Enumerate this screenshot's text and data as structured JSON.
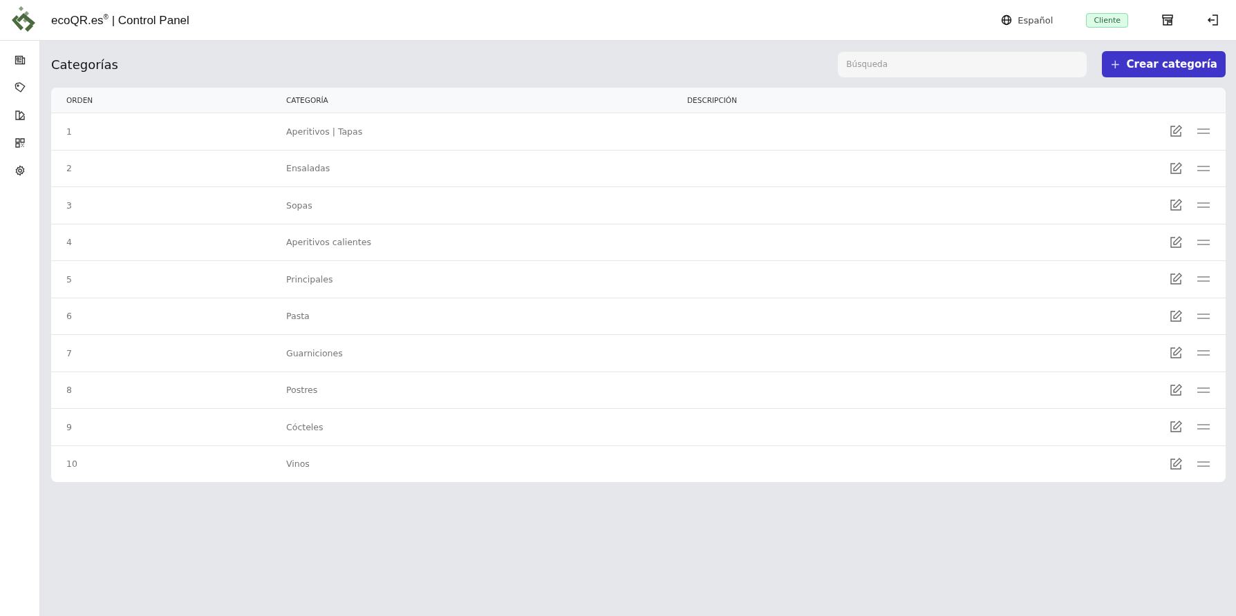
{
  "header": {
    "title": "ecoQR.es$^{®}$ | Control Panel",
    "language": "Español",
    "role_badge": "Cliente"
  },
  "page": {
    "title": "Categorías",
    "search": {
      "placeholder": "Búsqueda"
    },
    "create_button": {
      "icon": "+",
      "label": "Crear categoría"
    }
  },
  "table": {
    "columns": [
      "ORDEN",
      "CATEGORÍA",
      "DESCRIPCIÓN"
    ],
    "rows": [
      {
        "order": "1",
        "category": "Aperitivos | Tapas"
      },
      {
        "order": "2",
        "category": "Ensaladas"
      },
      {
        "order": "3",
        "category": "Sopas"
      },
      {
        "order": "4",
        "category": "Aperitivos calientes"
      },
      {
        "order": "5",
        "category": "Principales"
      },
      {
        "order": "6",
        "category": "Pasta"
      },
      {
        "order": "7",
        "category": "Guarniciones"
      },
      {
        "order": "8",
        "category": "Postres"
      },
      {
        "order": "9",
        "category": "Cócteles"
      },
      {
        "order": "10",
        "category": "Vinos"
      }
    ]
  }
}
